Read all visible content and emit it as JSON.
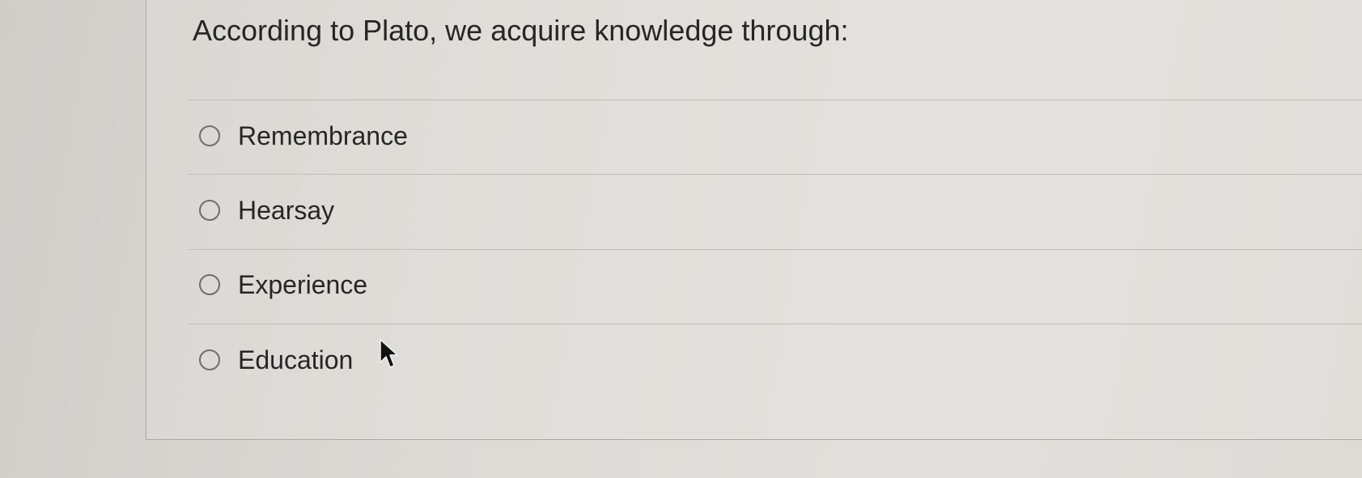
{
  "question": {
    "text": "According to Plato, we acquire knowledge through:"
  },
  "options": [
    {
      "label": "Remembrance",
      "selected": false
    },
    {
      "label": "Hearsay",
      "selected": false
    },
    {
      "label": "Experience",
      "selected": false
    },
    {
      "label": "Education",
      "selected": false
    }
  ],
  "icons": {
    "radio": "radio-button-unchecked-icon",
    "cursor": "mouse-pointer-icon"
  }
}
